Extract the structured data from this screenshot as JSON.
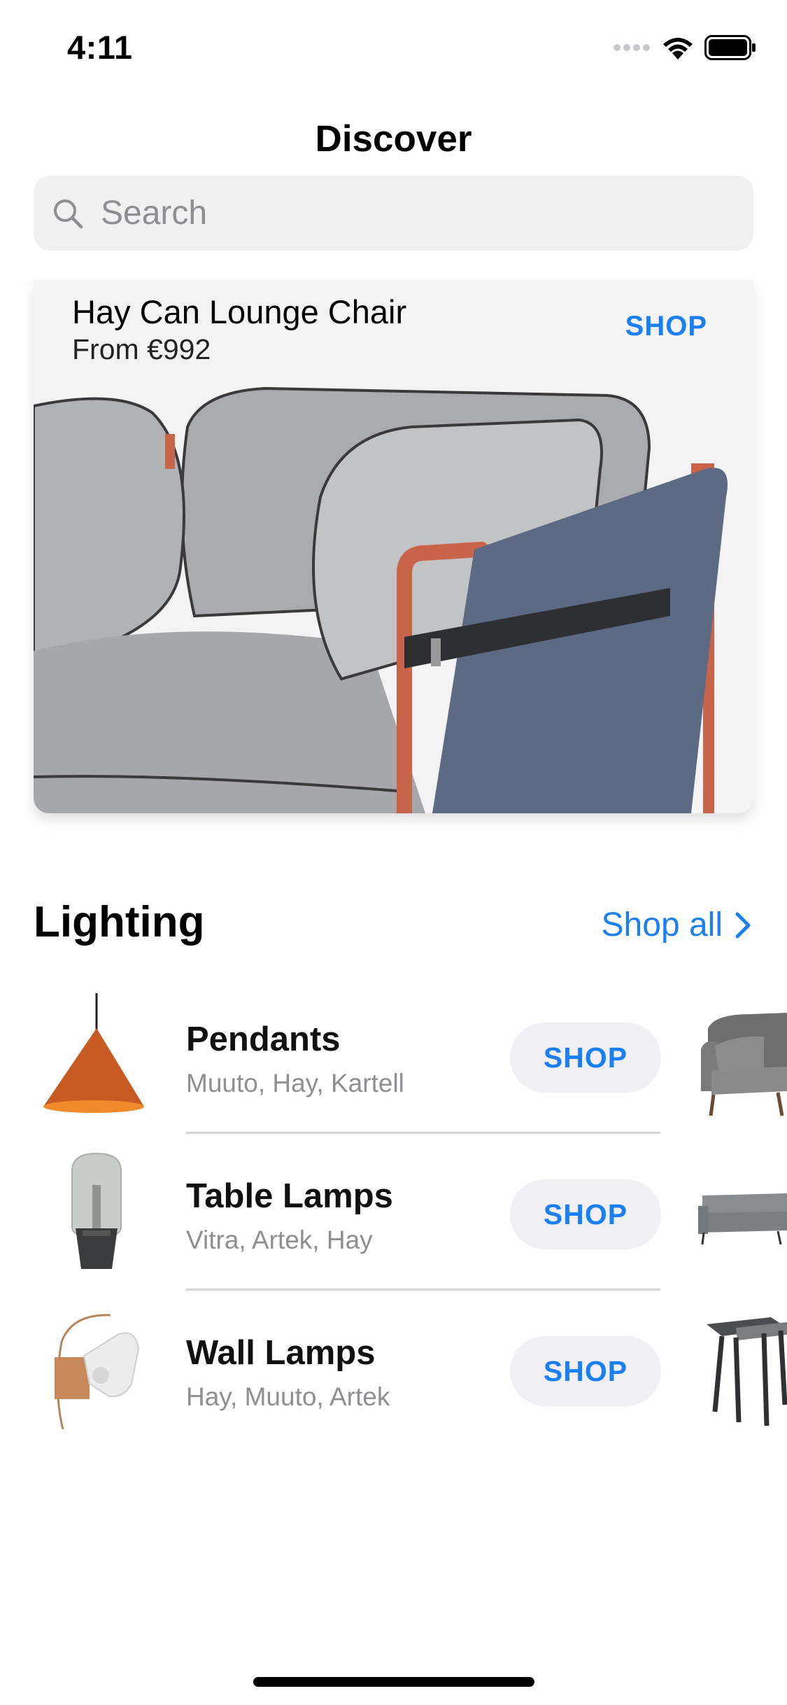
{
  "status_bar": {
    "time": "4:11"
  },
  "nav": {
    "title": "Discover",
    "search_placeholder": "Search"
  },
  "featured": {
    "name": "Hay Can Lounge Chair",
    "price": "From €992",
    "shop_label": "SHOP",
    "image": "lounge-chair-photo"
  },
  "section": {
    "title": "Lighting",
    "shop_all_label": "Shop all"
  },
  "items": [
    {
      "title": "Pendants",
      "brands": "Muuto, Hay, Kartell",
      "shop_label": "SHOP",
      "thumb": "pendant-lamp",
      "peek": "armchair"
    },
    {
      "title": "Table Lamps",
      "brands": "Vitra, Artek, Hay",
      "shop_label": "SHOP",
      "thumb": "table-lamp",
      "peek": "sofa"
    },
    {
      "title": "Wall Lamps",
      "brands": "Hay, Muuto, Artek",
      "shop_label": "SHOP",
      "thumb": "wall-lamp",
      "peek": "side-table"
    }
  ],
  "colors": {
    "accent": "#1a7ff0",
    "secondary_text": "#8e8e93",
    "search_bg": "#f0f0f0",
    "pill_bg": "#efeff4"
  }
}
